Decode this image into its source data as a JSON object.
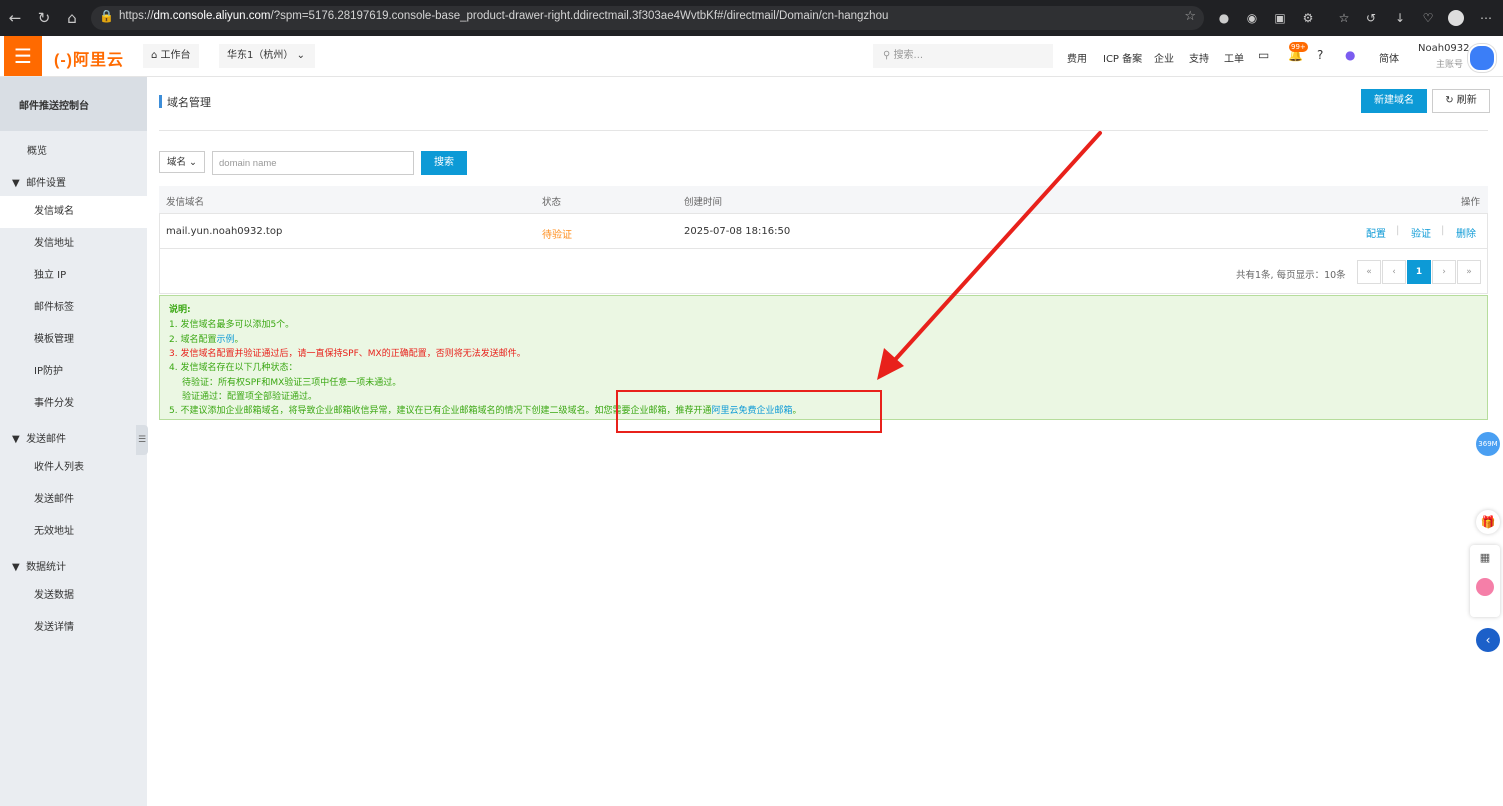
{
  "browser": {
    "url_prefix": "https://",
    "url_host": "dm.console.aliyun.com",
    "url_rest": "/?spm=5176.28197619.console-base_product-drawer-right.ddirectmail.3f303ae4WvtbKf#/directmail/Domain/cn-hangzhou"
  },
  "topbar": {
    "logo": "(-)阿里云",
    "workbench": "工作台",
    "region": "华东1（杭州）",
    "search_placeholder": "搜索...",
    "nav": [
      "费用",
      "ICP 备案",
      "企业",
      "支持",
      "工单"
    ],
    "badge": "99+",
    "lang": "简体",
    "user_name": "Noah0932",
    "user_role": "主账号"
  },
  "sidebar": {
    "title": "邮件推送控制台",
    "overview": "概览",
    "groups": [
      {
        "label": "邮件设置",
        "items": [
          "发信域名",
          "发信地址",
          "独立 IP",
          "邮件标签",
          "模板管理",
          "IP防护",
          "事件分发"
        ]
      },
      {
        "label": "发送邮件",
        "items": [
          "收件人列表",
          "发送邮件",
          "无效地址"
        ]
      },
      {
        "label": "数据统计",
        "items": [
          "发送数据",
          "发送详情"
        ]
      }
    ],
    "active_item": "发信域名"
  },
  "main": {
    "title": "域名管理",
    "btn_new": "新建域名",
    "btn_refresh": "刷新",
    "filter": {
      "select": "域名",
      "placeholder": "domain name",
      "search_label": "搜索"
    },
    "table": {
      "headers": [
        "发信域名",
        "状态",
        "创建时间",
        "操作"
      ],
      "rows": [
        {
          "domain": "mail.yun.noah0932.top",
          "status": "待验证",
          "created": "2025-07-08 18:16:50",
          "actions": [
            "配置",
            "验证",
            "删除"
          ]
        }
      ]
    },
    "pager": {
      "info": "共有1条, 每页显示：10条",
      "first": "«",
      "prev": "‹",
      "current": "1",
      "next": "›",
      "last": "»"
    },
    "note": {
      "title": "说明:",
      "line1": "1. 发信域名最多可以添加5个。",
      "line2_prefix": "2. 域名配置",
      "line2_link": "示例",
      "line2_suffix": "。",
      "line3": "3. 发信域名配置并验证通过后，请一直保持SPF、MX的正确配置，否则将无法发送邮件。",
      "line4": "4. 发信域名存在以下几种状态：",
      "line4a": "待验证：所有权SPF和MX验证三项中任意一项未通过。",
      "line4b": "验证通过：配置项全部验证通过。",
      "line5_prefix": "5. 不建议添加企业邮箱域名，将导致企业邮箱收信异常，建议在已有企业邮箱域名的情况下创建二级域名。如您需要企业邮箱，推荐开通",
      "line5_link": "阿里云免费企业邮箱",
      "line5_suffix": "。"
    }
  },
  "floating": {
    "badge": "369M"
  },
  "colors": {
    "accent": "#0d9ad6",
    "brand": "#ff6a00",
    "pending": "#ff8f1f",
    "note_green": "#3aa712",
    "note_red": "#e8211b",
    "annotation": "#e8211b"
  }
}
